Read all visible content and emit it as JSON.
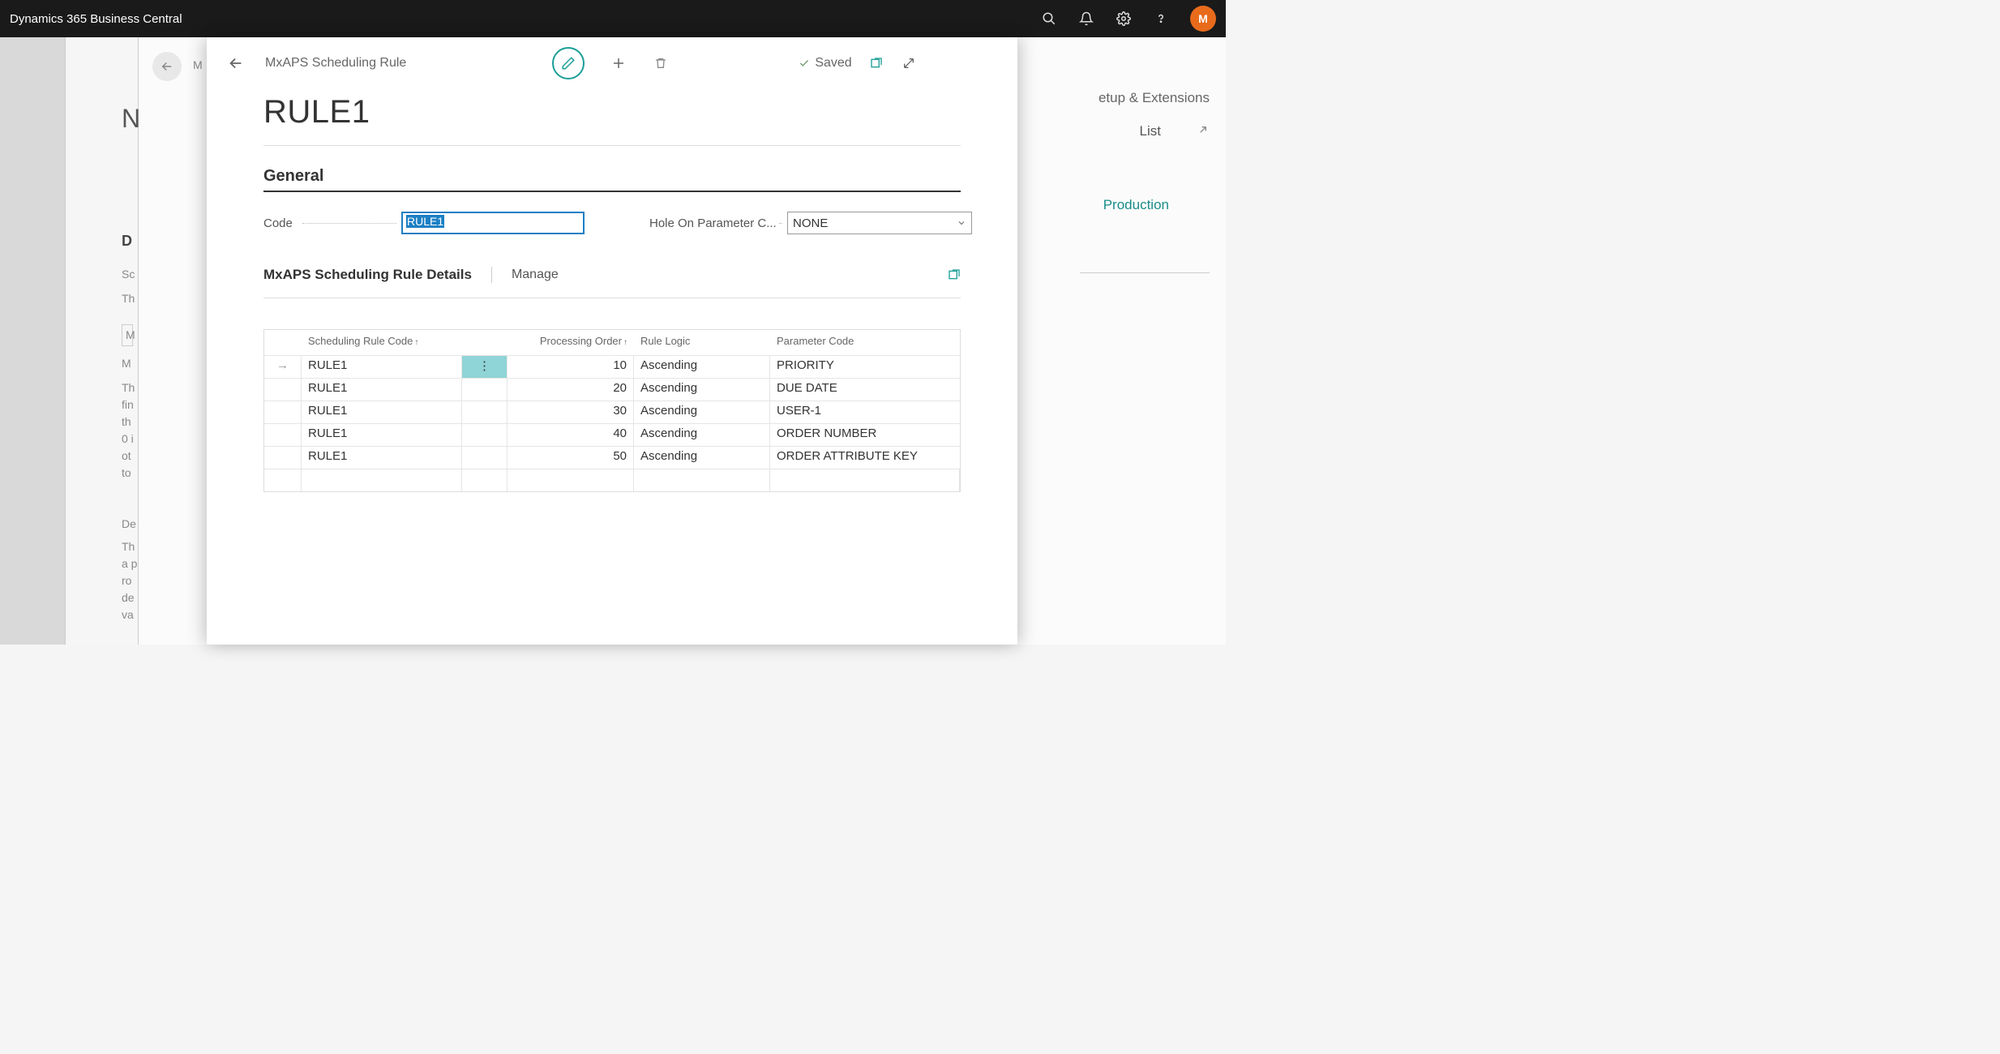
{
  "topbar": {
    "title": "Dynamics 365 Business Central",
    "avatar_initial": "M"
  },
  "bg": {
    "crumb": "M",
    "right_setup": "etup & Extensions",
    "right_list": "List",
    "right_prod": "Production",
    "left_n": "N",
    "left_d": "D",
    "left_sc": "Sc",
    "left_th": "Th",
    "left_m": "M",
    "left_m2": "M",
    "left_para1": "Th\nfin\nth\n0 i\not\nto",
    "left_de": "De",
    "left_para2": "Th\na p\nro\nde\nva"
  },
  "dialog": {
    "breadcrumb": "MxAPS Scheduling Rule",
    "saved": "Saved",
    "title": "RULE1",
    "section_general": "General",
    "code_label": "Code",
    "code_value": "RULE1",
    "param_label": "Hole On Parameter C...",
    "param_value": "NONE",
    "sub_title": "MxAPS Scheduling Rule Details",
    "manage": "Manage",
    "columns": {
      "code": "Scheduling Rule Code",
      "order": "Processing Order",
      "logic": "Rule Logic",
      "param": "Parameter Code"
    },
    "rows": [
      {
        "code": "RULE1",
        "order": "10",
        "logic": "Ascending",
        "param": "PRIORITY",
        "selected": true
      },
      {
        "code": "RULE1",
        "order": "20",
        "logic": "Ascending",
        "param": "DUE DATE"
      },
      {
        "code": "RULE1",
        "order": "30",
        "logic": "Ascending",
        "param": "USER-1"
      },
      {
        "code": "RULE1",
        "order": "40",
        "logic": "Ascending",
        "param": "ORDER NUMBER"
      },
      {
        "code": "RULE1",
        "order": "50",
        "logic": "Ascending",
        "param": "ORDER ATTRIBUTE KEY"
      }
    ]
  }
}
